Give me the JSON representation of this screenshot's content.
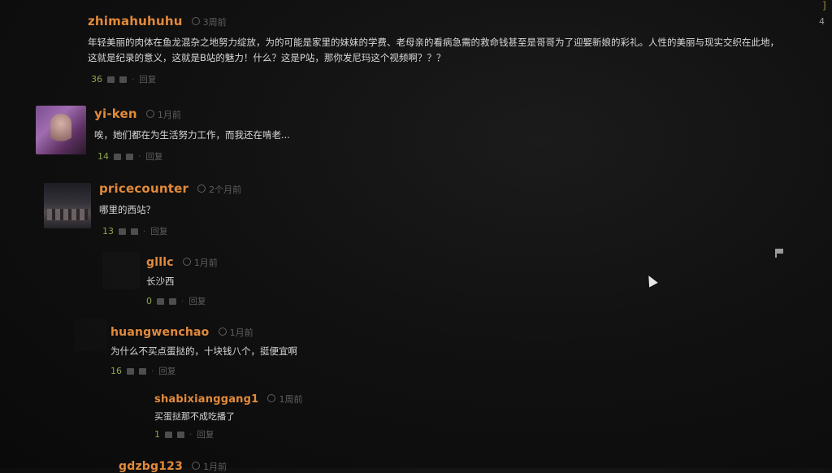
{
  "comments": [
    {
      "username": "zhimahuhuhu",
      "time": "3周前",
      "text_line1": "年轻美丽的肉体在鱼龙混杂之地努力绽放，为的可能是家里的妹妹的学费、老母亲的看病急需的救命钱甚至是哥哥为了迎娶新娘的彩礼。人性的美丽与现实交织在此地，",
      "text_line2": "这就是纪录的意义，这就是B站的魅力！什么？这是P站，那你发尼玛这个视频啊？？？",
      "likes": "36",
      "reply": "回复"
    },
    {
      "username": "yi-ken",
      "time": "1月前",
      "text": "唉，她们都在为生活努力工作，而我还在啃老...",
      "likes": "14",
      "reply": "回复"
    },
    {
      "username": "pricecounter",
      "time": "2个月前",
      "text": "哪里的西站？",
      "likes": "13",
      "reply": "回复"
    },
    {
      "username": "glllc",
      "time": "1月前",
      "text": "长沙西",
      "likes": "0",
      "reply": "回复"
    },
    {
      "username": "huangwenchao",
      "time": "1月前",
      "text": "为什么不买点蛋挞的，十块钱八个，挺便宜啊",
      "likes": "16",
      "reply": "回复"
    },
    {
      "username": "shabixianggang1",
      "time": "1周前",
      "text": "买蛋挞那不成吃播了",
      "likes": "1",
      "reply": "回复"
    },
    {
      "username": "gdzbg123",
      "time": "1月前"
    }
  ],
  "edge": {
    "number": "4"
  },
  "colors": {
    "username": "#e38a3a",
    "likes": "#8ba64a",
    "text": "#d9d9d9",
    "background": "#111111"
  }
}
